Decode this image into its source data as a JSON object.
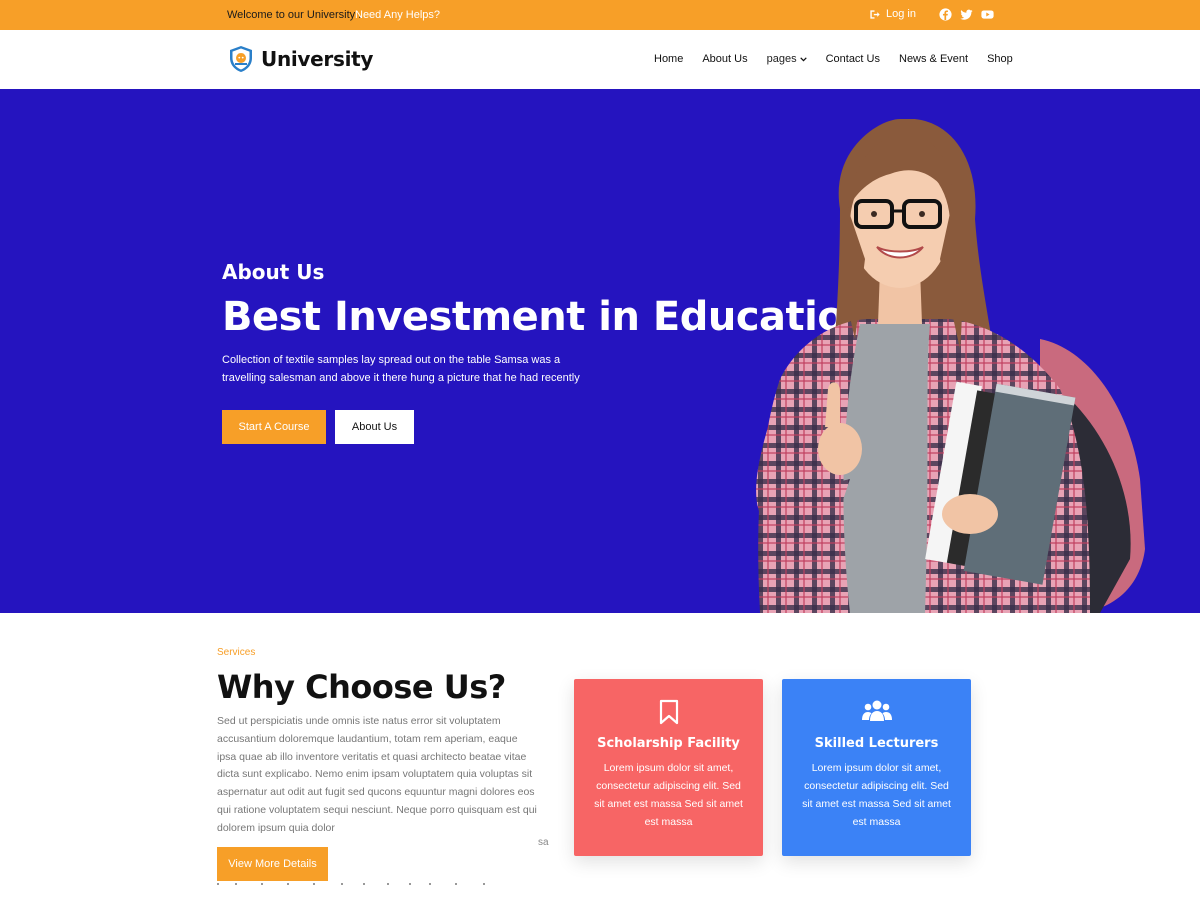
{
  "topbar": {
    "welcome": "Welcome to our University .",
    "help": "Need Any Helps?",
    "login": "Log in",
    "socials": [
      "facebook-icon",
      "twitter-icon",
      "youtube-icon"
    ]
  },
  "header": {
    "brand": "University",
    "nav": [
      {
        "label": "Home"
      },
      {
        "label": "About Us"
      },
      {
        "label": "pages"
      },
      {
        "label": "Contact Us"
      },
      {
        "label": "News & Event"
      },
      {
        "label": "Shop"
      }
    ]
  },
  "hero": {
    "kicker": "About Us",
    "title": "Best Investment in Education",
    "description": "Collection of textile samples lay spread out on the table Samsa was a travelling salesman and above it there hung a picture that he had recently",
    "primary_button": "Start A Course",
    "secondary_button": "About Us"
  },
  "services": {
    "kicker": "Services",
    "title": "Why Choose Us?",
    "body": "Sed ut perspiciatis unde omnis iste natus error sit voluptatem accusantium doloremque laudantium, totam rem aperiam, eaque ipsa quae ab illo inventore veritatis et quasi architecto beatae vitae dicta sunt explicabo. Nemo enim ipsam voluptatem quia voluptas sit aspernatur aut odit aut fugit sed qucons equuntur magni dolores eos qui ratione voluptatem sequi nesciunt. Neque porro quisquam est qui dolorem ipsum quia dolor",
    "stray": "sa",
    "button": "View More Details",
    "cards": [
      {
        "title": "Scholarship Facility",
        "text": "Lorem ipsum dolor sit amet, consectetur adipiscing elit. Sed sit amet est massa Sed sit amet est massa",
        "icon": "bookmark-icon"
      },
      {
        "title": "Skilled Lecturers",
        "text": "Lorem ipsum dolor sit amet, consectetur adipiscing elit. Sed sit amet est massa Sed sit amet est massa",
        "icon": "users-icon"
      }
    ]
  },
  "colors": {
    "accent": "#f79f28",
    "hero_bg": "#2514bf",
    "card_red": "#f76565",
    "card_blue": "#3b82f6"
  }
}
